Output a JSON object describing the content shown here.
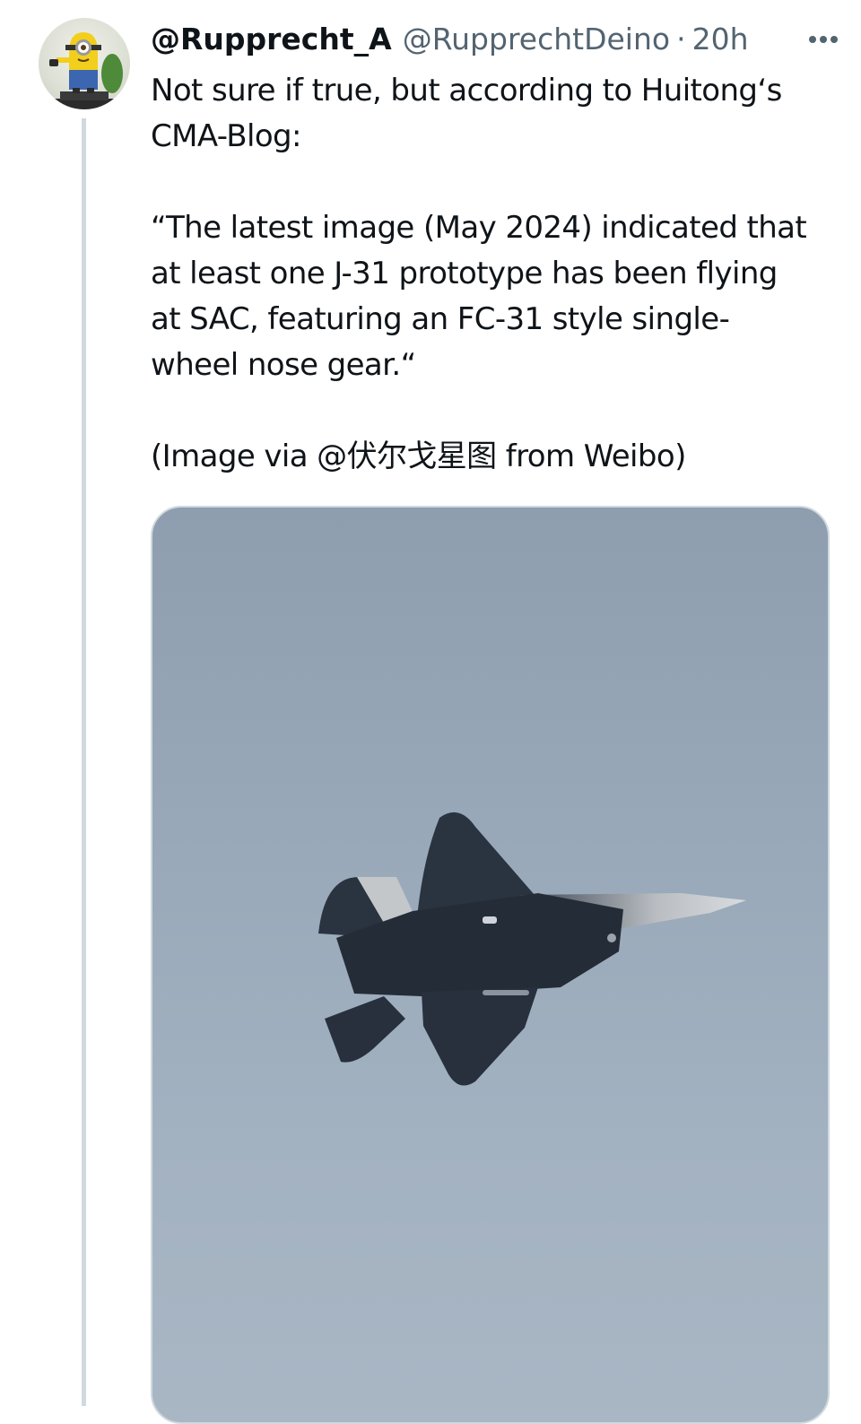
{
  "tweet": {
    "display_name": "@Rupprecht_A",
    "handle": "@RupprechtDeino",
    "separator": "·",
    "time": "20h",
    "more_icon": "more-horizontal-icon",
    "paragraphs": [
      "Not sure if true, but according to Huitong‘s\nCMA-Blog:",
      "“The latest image (May 2024) indicated that\nat least one J-31 prototype has been flying\nat SAC, featuring an FC-31 style single-\nwheel nose gear.“",
      "(Image via @伏尔戈星图  from  Weibo)"
    ]
  },
  "colors": {
    "text": "#0f1419",
    "secondary_text": "#536471",
    "thread_line": "#cfd9de",
    "sky": "#98a8b8",
    "aircraft": "#2a3340"
  }
}
